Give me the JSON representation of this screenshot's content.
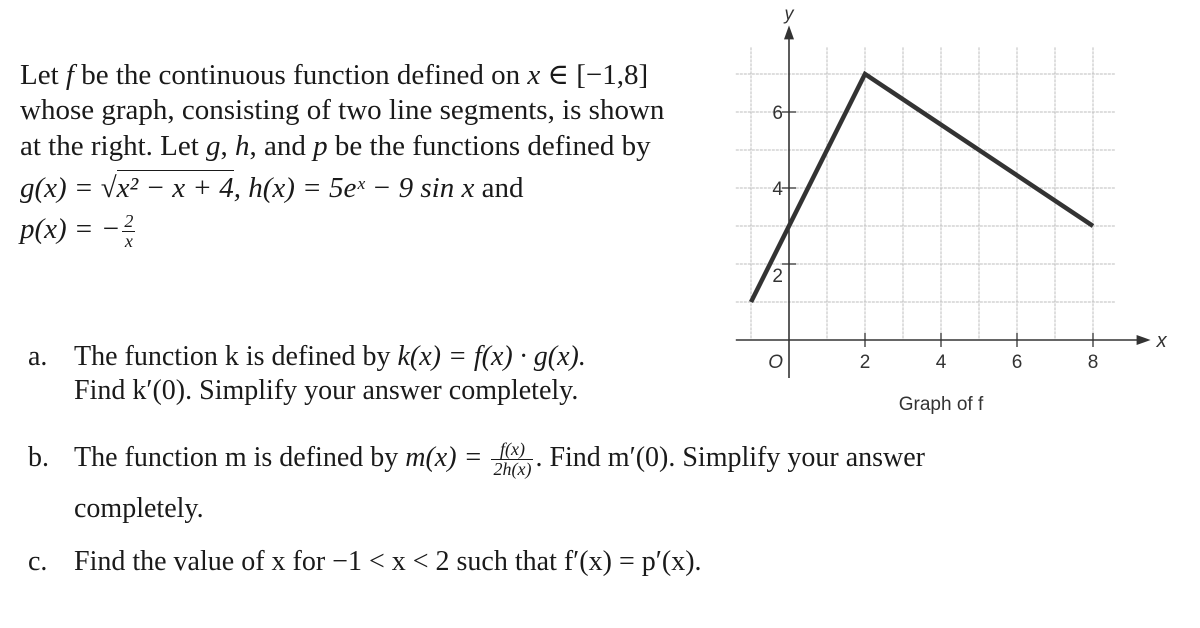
{
  "intro": {
    "line1": "Let f be the continuous function defined on x ∈ [−1,8]",
    "line1_pre": "Let ",
    "line1_f": "f",
    "line1_mid": " be the continuous function defined on ",
    "line1_x": "x",
    "line1_post": " ∈ [−1,8]",
    "line2": "whose graph, consisting of two line segments, is shown",
    "line3_pre": "at the right.  Let ",
    "line3_g": "g",
    "line3_c1": ", ",
    "line3_h": "h",
    "line3_c2": ", and ",
    "line3_p": "p",
    "line3_post": " be the functions defined by",
    "g_def_lhs": "g(x) = √",
    "g_def_radicand": "x² − x + 4",
    "h_def": ", h(x) = 5eˣ − 9 sin x",
    "and": " and",
    "p_def_lhs": "p(x) = −",
    "p_num": "2",
    "p_den": "x"
  },
  "questions": {
    "a": {
      "label": "a.",
      "line1_text": "The function k is defined by ",
      "line1_math": "k(x) = f(x) · g(x).",
      "line2": "Find k′(0).  Simplify your answer completely."
    },
    "b": {
      "label": "b.",
      "line1_text": "The function m is defined by ",
      "line1_math": "m(x) = ",
      "frac_num": "f(x)",
      "frac_den": "2h(x)",
      "line1_post": ".  Find m′(0). Simplify your answer",
      "line2": "completely."
    },
    "c": {
      "label": "c.",
      "text": "Find the value of x for −1 < x < 2 such that f′(x) = p′(x)."
    }
  },
  "chart_data": {
    "type": "line",
    "title": "Graph of f",
    "xlabel": "x",
    "ylabel": "y",
    "xlim": [
      -1,
      8
    ],
    "ylim": [
      0,
      7
    ],
    "x_ticks": [
      2,
      4,
      6,
      8
    ],
    "y_ticks": [
      2,
      4,
      6
    ],
    "origin_label": "O",
    "grid": true,
    "series": [
      {
        "name": "f",
        "x": [
          -1,
          2,
          8
        ],
        "y": [
          1,
          7,
          3
        ]
      }
    ]
  }
}
